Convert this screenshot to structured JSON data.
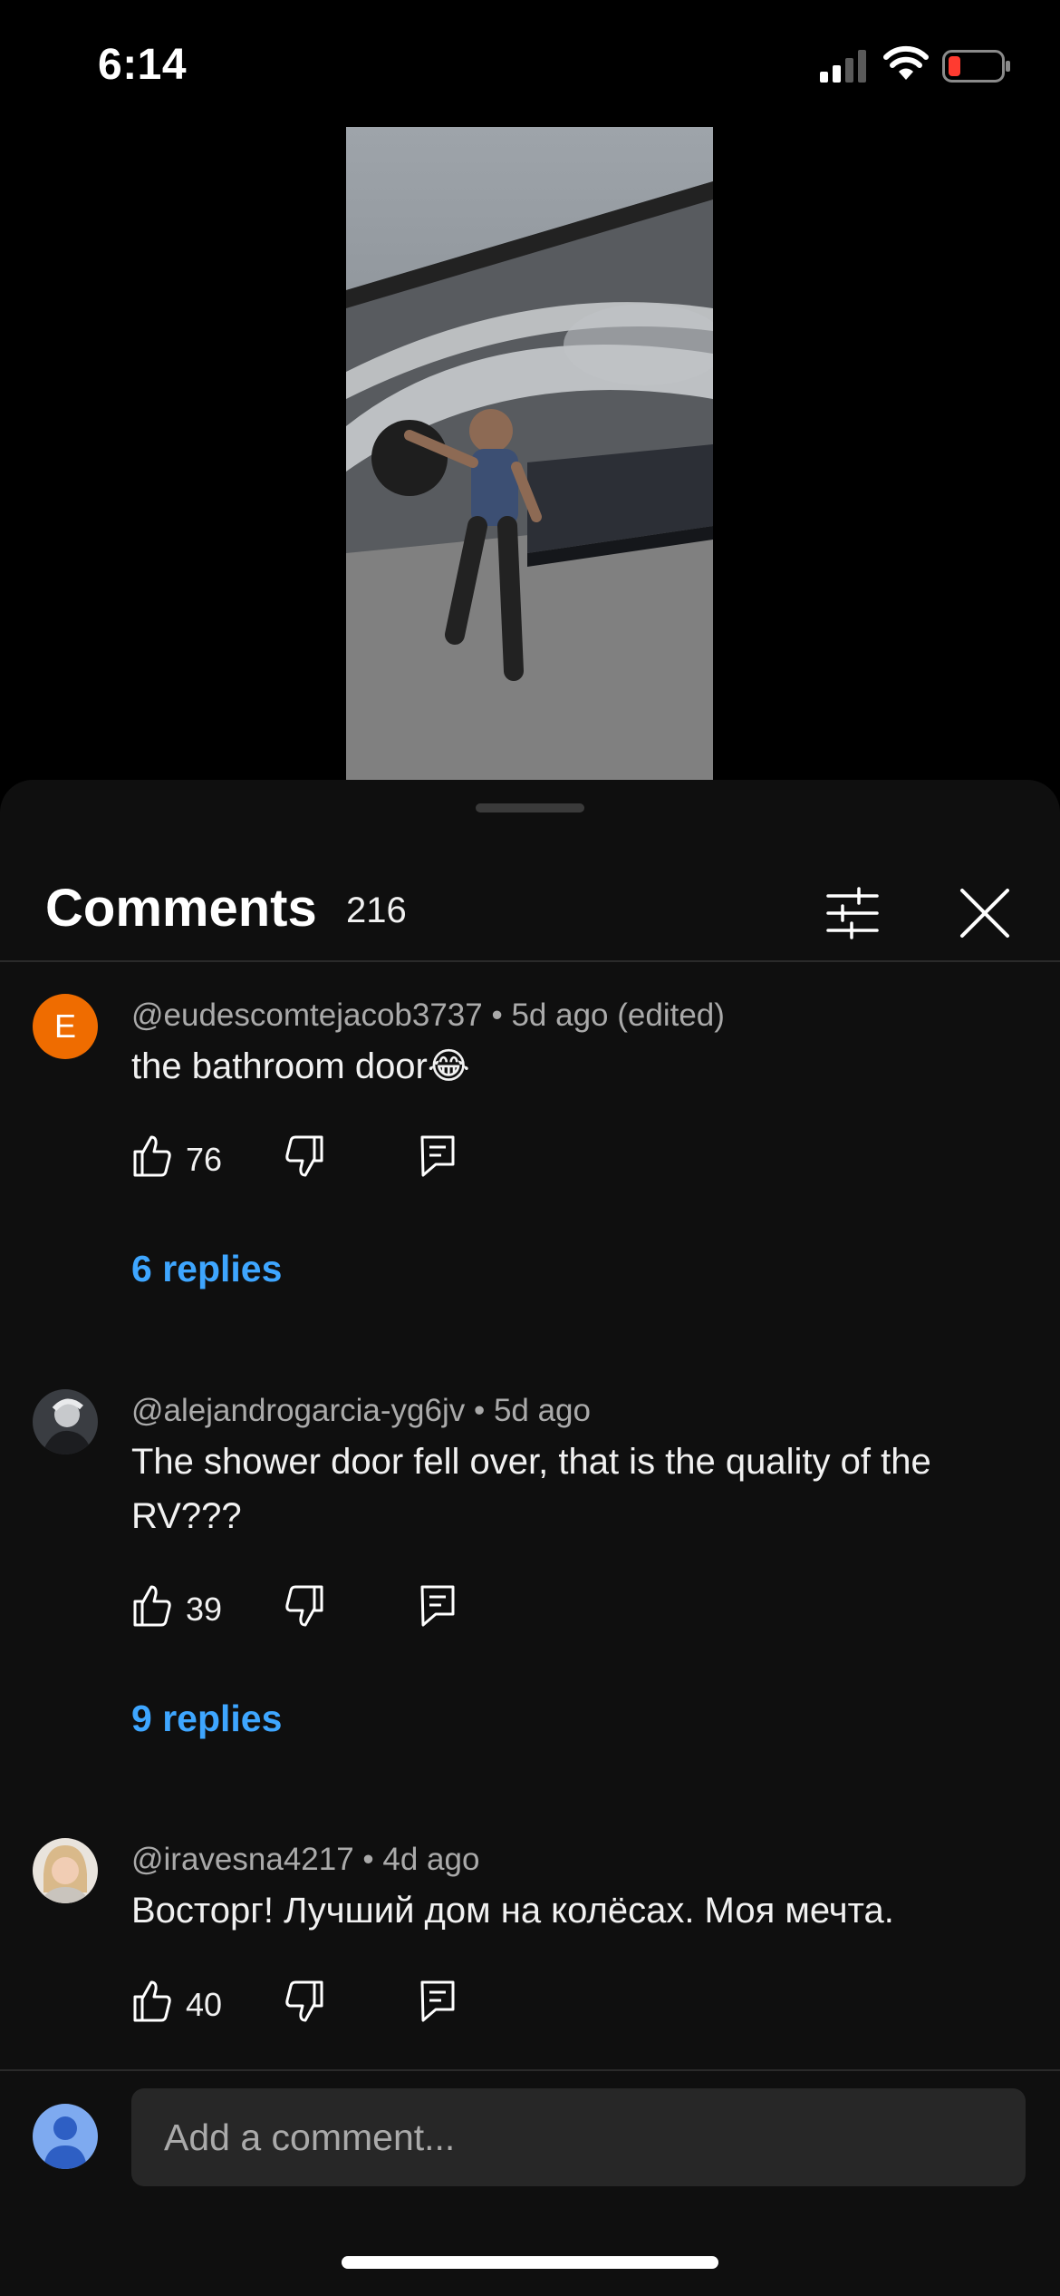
{
  "status_bar": {
    "time": "6:14"
  },
  "sheet": {
    "title": "Comments",
    "count": "216",
    "input_placeholder": "Add a comment..."
  },
  "comments": [
    {
      "avatar_letter": "E",
      "avatar_color": "#ef6c00",
      "author": "@eudescomtejacob3737",
      "time": "5d ago (edited)",
      "text": "the bathroom door😂",
      "likes": "76",
      "replies": "6 replies"
    },
    {
      "author": "@alejandrogarcia-yg6jv",
      "time": "5d ago",
      "text": "The shower door fell over, that is the quality of the RV???",
      "likes": "39",
      "replies": "9 replies"
    },
    {
      "author": "@iravesna4217",
      "time": "4d ago",
      "text": "Восторг! Лучший дом на колёсах. Моя мечта.",
      "likes": "40"
    }
  ],
  "colors": {
    "accent": "#3ea6ff",
    "background": "#0f0f0f"
  }
}
